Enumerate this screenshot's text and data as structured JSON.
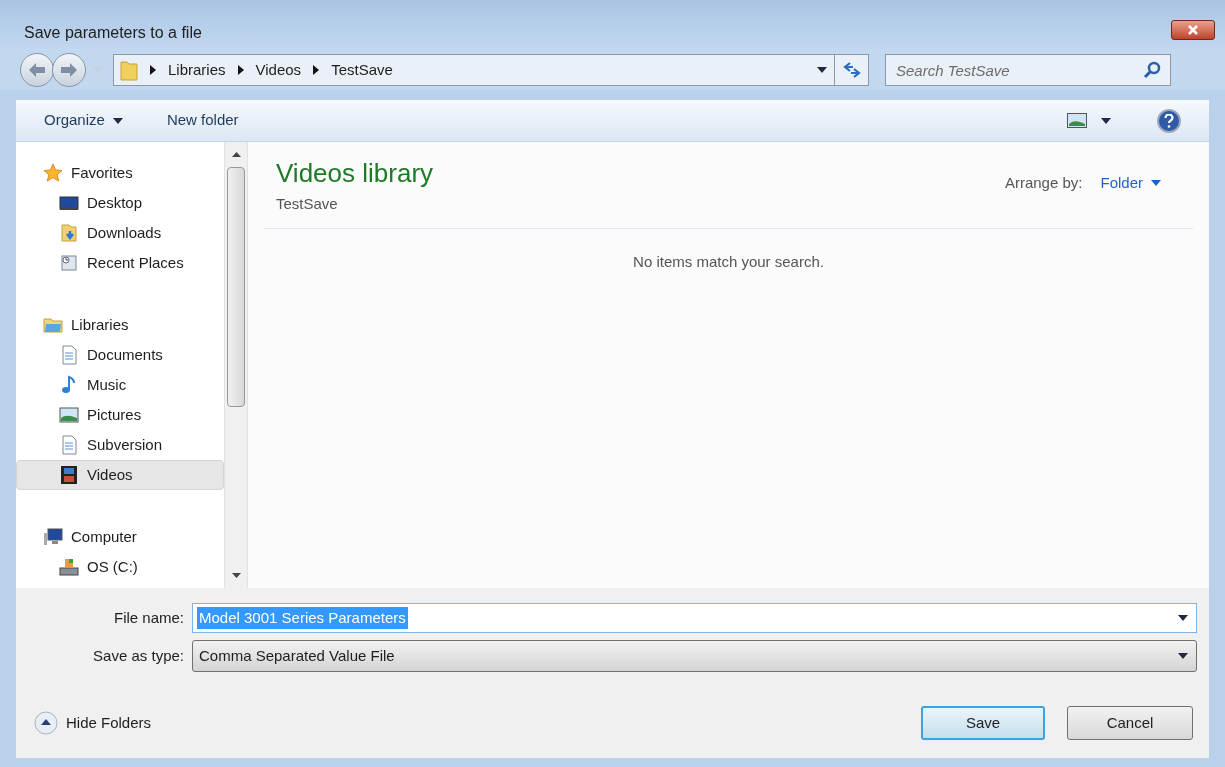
{
  "window": {
    "title": "Save parameters to a file"
  },
  "breadcrumb": [
    "Libraries",
    "Videos",
    "TestSave"
  ],
  "search": {
    "placeholder": "Search TestSave"
  },
  "toolbar": {
    "organize": "Organize",
    "new_folder": "New folder"
  },
  "nav_tree": [
    {
      "label": "Favorites",
      "kind": "star",
      "selected": false,
      "children": [
        {
          "label": "Desktop",
          "kind": "desktop",
          "selected": false
        },
        {
          "label": "Downloads",
          "kind": "downloads",
          "selected": false
        },
        {
          "label": "Recent Places",
          "kind": "recent",
          "selected": false
        }
      ]
    },
    {
      "label": "Libraries",
      "kind": "library",
      "selected": false,
      "children": [
        {
          "label": "Documents",
          "kind": "document",
          "selected": false
        },
        {
          "label": "Music",
          "kind": "music",
          "selected": false
        },
        {
          "label": "Pictures",
          "kind": "pictures",
          "selected": false
        },
        {
          "label": "Subversion",
          "kind": "document",
          "selected": false
        },
        {
          "label": "Videos",
          "kind": "videos",
          "selected": true
        }
      ]
    },
    {
      "label": "Computer",
      "kind": "computer",
      "selected": false,
      "children": [
        {
          "label": "OS (C:)",
          "kind": "drive",
          "selected": false
        }
      ]
    }
  ],
  "content": {
    "title": "Videos library",
    "subtitle": "TestSave",
    "arrange_label": "Arrange by:",
    "arrange_value": "Folder",
    "empty_message": "No items match your search."
  },
  "file_name": {
    "label": "File name:",
    "value": "Model 3001 Series Parameters"
  },
  "save_as_type": {
    "label": "Save as type:",
    "value": "Comma Separated Value File"
  },
  "hide_folders": "Hide Folders",
  "buttons": {
    "save": "Save",
    "cancel": "Cancel"
  }
}
